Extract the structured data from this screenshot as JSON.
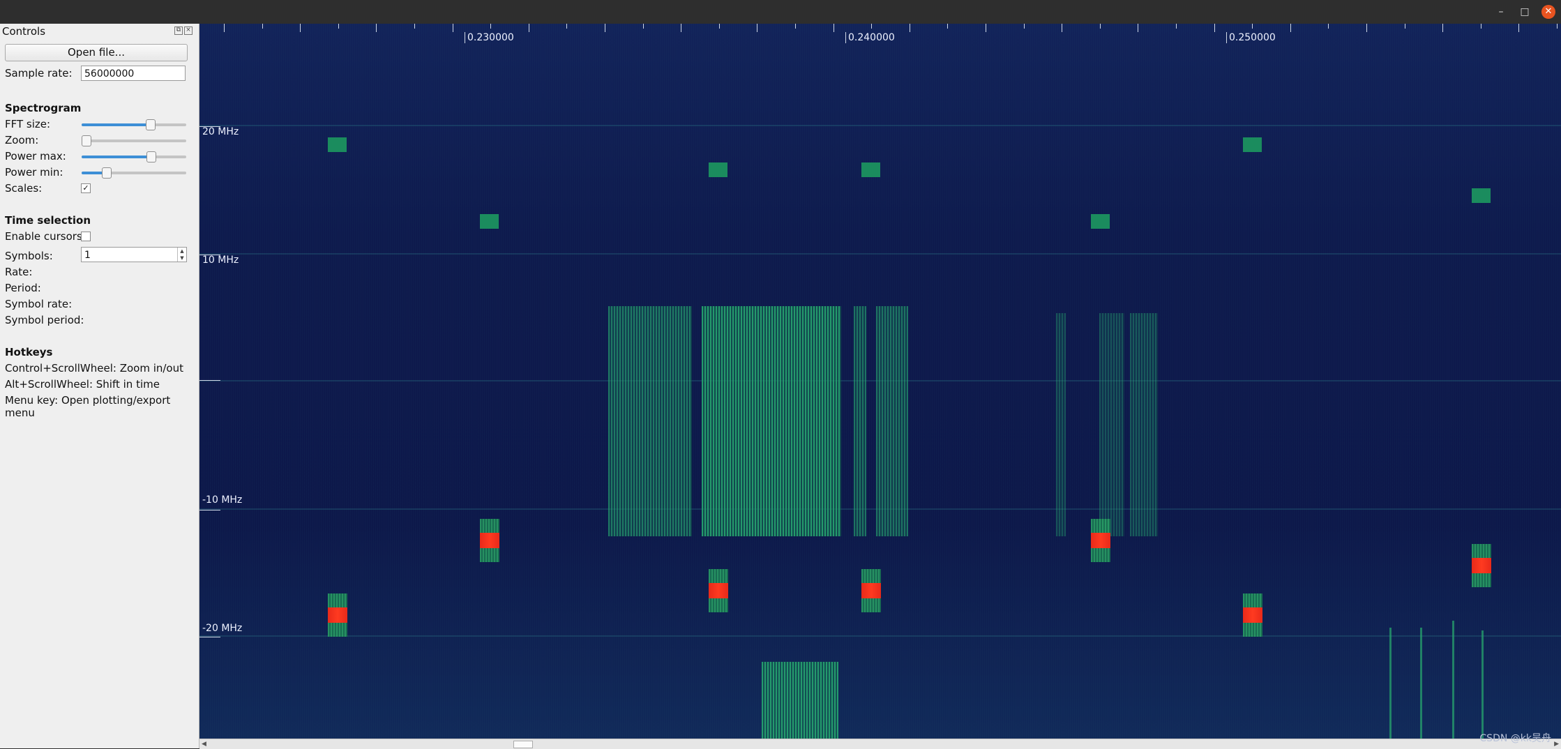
{
  "window": {
    "minimize_glyph": "–",
    "maximize_glyph": "□",
    "close_glyph": "✕"
  },
  "controls": {
    "title": "Controls",
    "open_file_label": "Open file...",
    "sample_rate_label": "Sample rate:",
    "sample_rate_value": "56000000",
    "spectrogram_header": "Spectrogram",
    "fft_size_label": "FFT size:",
    "fft_size_level": 0.65,
    "zoom_label": "Zoom:",
    "zoom_level": 0.0,
    "power_max_label": "Power max:",
    "power_max_level": 0.66,
    "power_min_label": "Power min:",
    "power_min_level": 0.23,
    "scales_label": "Scales:",
    "scales_checked": true,
    "time_selection_header": "Time selection",
    "enable_cursors_label": "Enable cursors:",
    "enable_cursors_checked": false,
    "symbols_label": "Symbols:",
    "symbols_value": "1",
    "rate_label": "Rate:",
    "period_label": "Period:",
    "symbol_rate_label": "Symbol rate:",
    "symbol_period_label": "Symbol period:",
    "hotkeys_header": "Hotkeys",
    "hotkey_1": "Control+ScrollWheel: Zoom in/out",
    "hotkey_2": "Alt+ScrollWheel: Shift in time",
    "hotkey_3": "Menu key: Open plotting/export menu"
  },
  "spectrogram": {
    "time_labels": [
      "0.230000",
      "0.240000",
      "0.250000"
    ],
    "freq_labels": [
      "20 MHz",
      "10 MHz",
      "-10 MHz",
      "-20 MHz"
    ],
    "colors": {
      "background": "#0e1a4d",
      "signal": "#1b8c5e",
      "peak": "#ff3a20"
    }
  },
  "watermark": "CSDN @kk吴舟"
}
